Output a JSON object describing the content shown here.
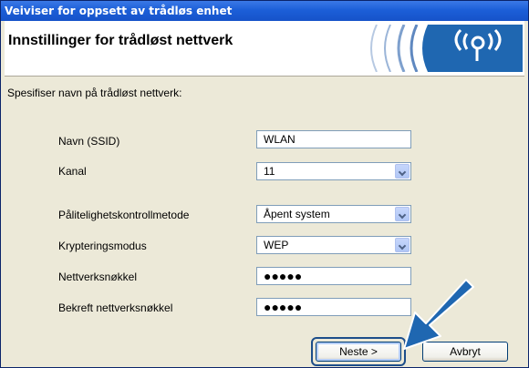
{
  "window": {
    "title": "Veiviser for oppsett av trådløs enhet"
  },
  "header": {
    "title": "Innstillinger for trådløst nettverk"
  },
  "instruction": "Spesifiser navn på trådløst nettverk:",
  "fields": [
    {
      "label": "Navn (SSID)",
      "value": "WLAN"
    },
    {
      "label": "Kanal",
      "value": "11"
    },
    {
      "label": "Pålitelighetskontrollmetode",
      "value": "Åpent system"
    },
    {
      "label": "Krypteringsmodus",
      "value": "WEP"
    },
    {
      "label": "Nettverksnøkkel",
      "value": "●●●●●"
    },
    {
      "label": "Bekreft nettverksnøkkel",
      "value": "●●●●●"
    }
  ],
  "buttons": {
    "next": "Neste >",
    "cancel": "Avbryt"
  },
  "colors": {
    "titlebar": "#1c5fd8",
    "arrow": "#1f67b1",
    "logo": "#1f67b1"
  }
}
